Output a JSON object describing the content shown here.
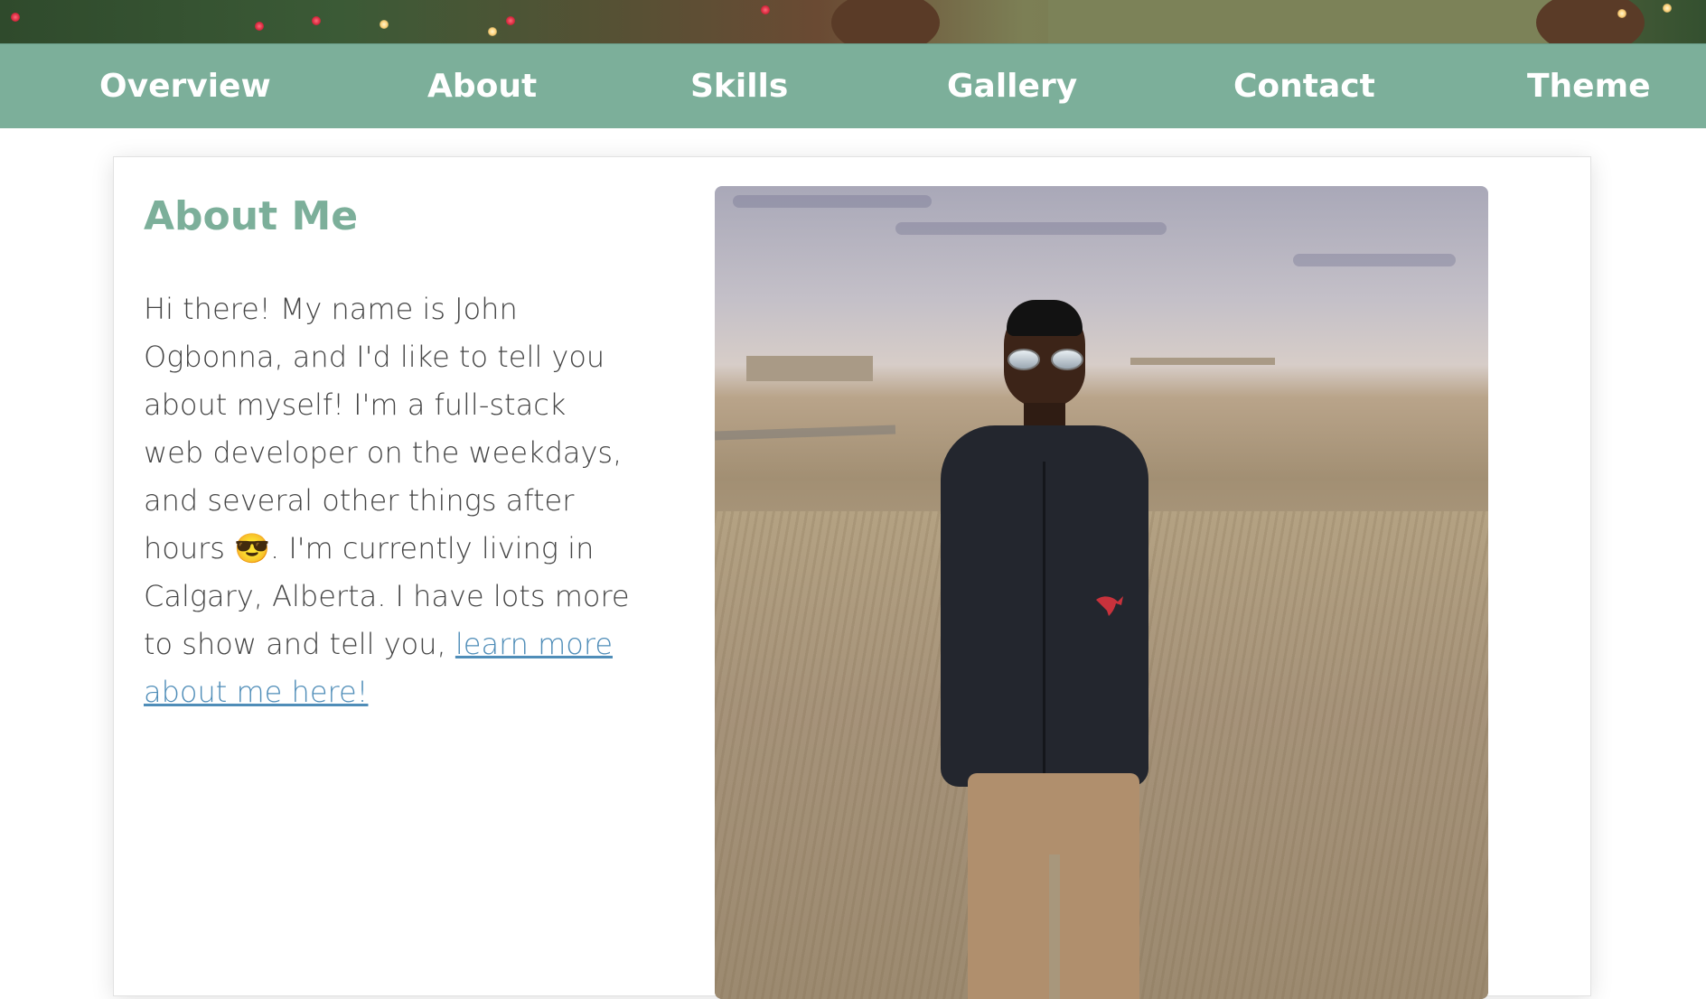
{
  "nav": {
    "items": [
      {
        "label": "Overview"
      },
      {
        "label": "About"
      },
      {
        "label": "Skills"
      },
      {
        "label": "Gallery"
      },
      {
        "label": "Contact"
      },
      {
        "label": "Theme"
      }
    ]
  },
  "about": {
    "title": "About Me",
    "text_before_link": "Hi there! My name is John Ogbonna, and I'd like to tell you about myself! I'm a full-stack web developer on the weekdays, and several other things after hours 😎. I'm currently living in Calgary, Alberta. I have lots more to show and tell you, ",
    "link_text": "learn more about me here!"
  },
  "colors": {
    "accent": "#7caf9a",
    "link": "#4f8db8",
    "body_text": "#444444"
  },
  "icons": {
    "emoji": "smiling-face-with-sunglasses"
  }
}
